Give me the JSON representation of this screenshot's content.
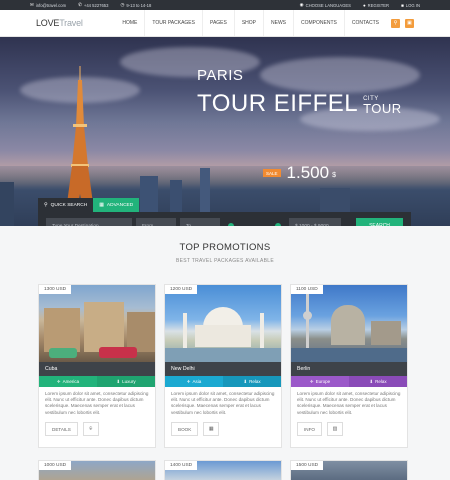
{
  "topbar": {
    "email": "info@travel.com",
    "phone": "+44 5227653",
    "hours": "9-13 to 14-18",
    "languages": "CHOOSE LANGUAGES",
    "register": "REGISTER",
    "login": "LOG IN"
  },
  "nav": {
    "logo_main": "LOVE",
    "logo_accent": "Travel",
    "items": [
      "HOME",
      "TOUR PACKAGES",
      "PAGES",
      "SHOP",
      "NEWS",
      "COMPONENTS",
      "CONTACTS"
    ]
  },
  "hero": {
    "city": "PARIS",
    "title": "TOUR EIFFEL",
    "sub1": "CITY",
    "sub2": "TOUR",
    "sale": "SALE",
    "price": "1.500",
    "currency": "$"
  },
  "search": {
    "tab_quick": "QUICK SEARCH",
    "tab_advanced": "ADVANCED",
    "destination_placeholder": "Type Your Destination",
    "from_placeholder": "From",
    "to_placeholder": "To",
    "price_range": "$ 1000 - $ 9000",
    "button": "SEARCH"
  },
  "promotions": {
    "title": "TOP PROMOTIONS",
    "subtitle": "BEST TRAVEL PACKAGES AVAILABLE",
    "cards": [
      {
        "price": "1300 USD",
        "name": "Cuba",
        "tag1": "America",
        "tag2": "Luxury",
        "color": "#22b37b",
        "desc": "Lorem ipsum dolor sit amet, consectetur adipiscing elit. Nunc ut efficitur ante. Donec dapibus dictum scelerisque. Maecenas semper erat et lacus vestibulum nec lobortis elit.",
        "action": "DETAILS"
      },
      {
        "price": "1200 USD",
        "name": "New Delhi",
        "tag1": "Asia",
        "tag2": "Relax",
        "color": "#1ba9d1",
        "desc": "Lorem ipsum dolor sit amet, consectetur adipiscing elit. Nunc ut efficitur ante. Donec dapibus dictum scelerisque. Maecenas semper erat et lacus vestibulum nec lobortis elit.",
        "action": "BOOK"
      },
      {
        "price": "1100 USD",
        "name": "Berlin",
        "tag1": "Europe",
        "tag2": "Relax",
        "color": "#9b59c9",
        "desc": "Lorem ipsum dolor sit amet, consectetur adipiscing elit. Nunc ut efficitur ante. Donec dapibus dictum scelerisque. Maecenas semper erat et lacus vestibulum nec lobortis elit.",
        "action": "INFO"
      }
    ],
    "row2": [
      "1000 USD",
      "1400 USD",
      "1500 USD"
    ]
  }
}
